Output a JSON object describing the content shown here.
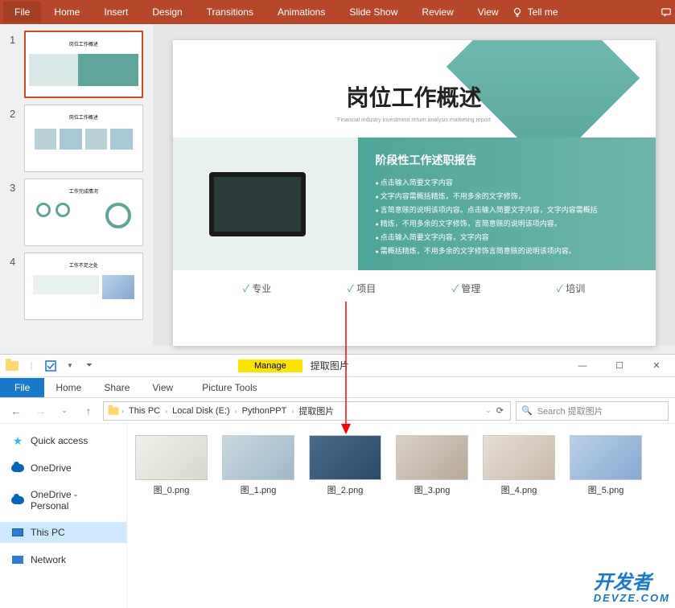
{
  "ppt": {
    "ribbon": [
      "File",
      "Home",
      "Insert",
      "Design",
      "Transitions",
      "Animations",
      "Slide Show",
      "Review",
      "View"
    ],
    "tellme": "Tell me",
    "slides": [
      1,
      2,
      3,
      4
    ],
    "current_slide": {
      "title": "岗位工作概述",
      "subtitle": "Financial industry investment return analysis marketing report",
      "section_title": "阶段性工作述职报告",
      "bullets": [
        "点击输入简要文字内容",
        "文字内容需概括精炼，不用多余的文字修饰，",
        "言简意赅的说明该项内容。点击输入简要文字内容，文字内容需概括",
        "精炼，不用多余的文字修饰，言简意赅的说明该项内容。",
        "点击输入简要文字内容，文字内容",
        "需概括精炼，不用多余的文字修饰言简意赅的说明该项内容。"
      ],
      "bottom": [
        "专业",
        "项目",
        "管理",
        "培训"
      ]
    }
  },
  "explorer": {
    "manage": "Manage",
    "picture_tools": "Picture Tools",
    "title": "提取图片",
    "file_tab": "File",
    "tabs": [
      "Home",
      "Share",
      "View"
    ],
    "breadcrumbs": [
      "This PC",
      "Local Disk (E:)",
      "PythonPPT",
      "提取图片"
    ],
    "search_placeholder": "Search 提取图片",
    "nav": {
      "quick": "Quick access",
      "onedrive": "OneDrive",
      "onedrive_p": "OneDrive - Personal",
      "thispc": "This PC",
      "network": "Network"
    },
    "files": [
      {
        "name": "图_0.png"
      },
      {
        "name": "图_1.png"
      },
      {
        "name": "图_2.png"
      },
      {
        "name": "图_3.png"
      },
      {
        "name": "图_4.png"
      },
      {
        "name": "图_5.png"
      }
    ]
  },
  "watermark": {
    "big": "开发者",
    "small": "DEVZE.COM"
  }
}
